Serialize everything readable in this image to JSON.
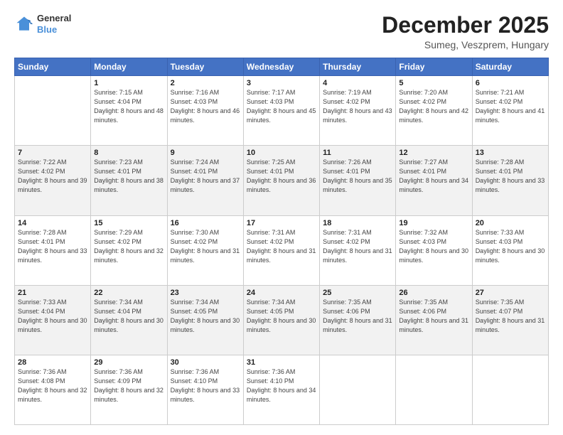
{
  "header": {
    "logo_general": "General",
    "logo_blue": "Blue",
    "month_year": "December 2025",
    "location": "Sumeg, Veszprem, Hungary"
  },
  "calendar": {
    "days_of_week": [
      "Sunday",
      "Monday",
      "Tuesday",
      "Wednesday",
      "Thursday",
      "Friday",
      "Saturday"
    ],
    "weeks": [
      [
        {
          "day": "",
          "sunrise": "",
          "sunset": "",
          "daylight": ""
        },
        {
          "day": "1",
          "sunrise": "Sunrise: 7:15 AM",
          "sunset": "Sunset: 4:04 PM",
          "daylight": "Daylight: 8 hours and 48 minutes."
        },
        {
          "day": "2",
          "sunrise": "Sunrise: 7:16 AM",
          "sunset": "Sunset: 4:03 PM",
          "daylight": "Daylight: 8 hours and 46 minutes."
        },
        {
          "day": "3",
          "sunrise": "Sunrise: 7:17 AM",
          "sunset": "Sunset: 4:03 PM",
          "daylight": "Daylight: 8 hours and 45 minutes."
        },
        {
          "day": "4",
          "sunrise": "Sunrise: 7:19 AM",
          "sunset": "Sunset: 4:02 PM",
          "daylight": "Daylight: 8 hours and 43 minutes."
        },
        {
          "day": "5",
          "sunrise": "Sunrise: 7:20 AM",
          "sunset": "Sunset: 4:02 PM",
          "daylight": "Daylight: 8 hours and 42 minutes."
        },
        {
          "day": "6",
          "sunrise": "Sunrise: 7:21 AM",
          "sunset": "Sunset: 4:02 PM",
          "daylight": "Daylight: 8 hours and 41 minutes."
        }
      ],
      [
        {
          "day": "7",
          "sunrise": "Sunrise: 7:22 AM",
          "sunset": "Sunset: 4:02 PM",
          "daylight": "Daylight: 8 hours and 39 minutes."
        },
        {
          "day": "8",
          "sunrise": "Sunrise: 7:23 AM",
          "sunset": "Sunset: 4:01 PM",
          "daylight": "Daylight: 8 hours and 38 minutes."
        },
        {
          "day": "9",
          "sunrise": "Sunrise: 7:24 AM",
          "sunset": "Sunset: 4:01 PM",
          "daylight": "Daylight: 8 hours and 37 minutes."
        },
        {
          "day": "10",
          "sunrise": "Sunrise: 7:25 AM",
          "sunset": "Sunset: 4:01 PM",
          "daylight": "Daylight: 8 hours and 36 minutes."
        },
        {
          "day": "11",
          "sunrise": "Sunrise: 7:26 AM",
          "sunset": "Sunset: 4:01 PM",
          "daylight": "Daylight: 8 hours and 35 minutes."
        },
        {
          "day": "12",
          "sunrise": "Sunrise: 7:27 AM",
          "sunset": "Sunset: 4:01 PM",
          "daylight": "Daylight: 8 hours and 34 minutes."
        },
        {
          "day": "13",
          "sunrise": "Sunrise: 7:28 AM",
          "sunset": "Sunset: 4:01 PM",
          "daylight": "Daylight: 8 hours and 33 minutes."
        }
      ],
      [
        {
          "day": "14",
          "sunrise": "Sunrise: 7:28 AM",
          "sunset": "Sunset: 4:01 PM",
          "daylight": "Daylight: 8 hours and 33 minutes."
        },
        {
          "day": "15",
          "sunrise": "Sunrise: 7:29 AM",
          "sunset": "Sunset: 4:02 PM",
          "daylight": "Daylight: 8 hours and 32 minutes."
        },
        {
          "day": "16",
          "sunrise": "Sunrise: 7:30 AM",
          "sunset": "Sunset: 4:02 PM",
          "daylight": "Daylight: 8 hours and 31 minutes."
        },
        {
          "day": "17",
          "sunrise": "Sunrise: 7:31 AM",
          "sunset": "Sunset: 4:02 PM",
          "daylight": "Daylight: 8 hours and 31 minutes."
        },
        {
          "day": "18",
          "sunrise": "Sunrise: 7:31 AM",
          "sunset": "Sunset: 4:02 PM",
          "daylight": "Daylight: 8 hours and 31 minutes."
        },
        {
          "day": "19",
          "sunrise": "Sunrise: 7:32 AM",
          "sunset": "Sunset: 4:03 PM",
          "daylight": "Daylight: 8 hours and 30 minutes."
        },
        {
          "day": "20",
          "sunrise": "Sunrise: 7:33 AM",
          "sunset": "Sunset: 4:03 PM",
          "daylight": "Daylight: 8 hours and 30 minutes."
        }
      ],
      [
        {
          "day": "21",
          "sunrise": "Sunrise: 7:33 AM",
          "sunset": "Sunset: 4:04 PM",
          "daylight": "Daylight: 8 hours and 30 minutes."
        },
        {
          "day": "22",
          "sunrise": "Sunrise: 7:34 AM",
          "sunset": "Sunset: 4:04 PM",
          "daylight": "Daylight: 8 hours and 30 minutes."
        },
        {
          "day": "23",
          "sunrise": "Sunrise: 7:34 AM",
          "sunset": "Sunset: 4:05 PM",
          "daylight": "Daylight: 8 hours and 30 minutes."
        },
        {
          "day": "24",
          "sunrise": "Sunrise: 7:34 AM",
          "sunset": "Sunset: 4:05 PM",
          "daylight": "Daylight: 8 hours and 30 minutes."
        },
        {
          "day": "25",
          "sunrise": "Sunrise: 7:35 AM",
          "sunset": "Sunset: 4:06 PM",
          "daylight": "Daylight: 8 hours and 31 minutes."
        },
        {
          "day": "26",
          "sunrise": "Sunrise: 7:35 AM",
          "sunset": "Sunset: 4:06 PM",
          "daylight": "Daylight: 8 hours and 31 minutes."
        },
        {
          "day": "27",
          "sunrise": "Sunrise: 7:35 AM",
          "sunset": "Sunset: 4:07 PM",
          "daylight": "Daylight: 8 hours and 31 minutes."
        }
      ],
      [
        {
          "day": "28",
          "sunrise": "Sunrise: 7:36 AM",
          "sunset": "Sunset: 4:08 PM",
          "daylight": "Daylight: 8 hours and 32 minutes."
        },
        {
          "day": "29",
          "sunrise": "Sunrise: 7:36 AM",
          "sunset": "Sunset: 4:09 PM",
          "daylight": "Daylight: 8 hours and 32 minutes."
        },
        {
          "day": "30",
          "sunrise": "Sunrise: 7:36 AM",
          "sunset": "Sunset: 4:10 PM",
          "daylight": "Daylight: 8 hours and 33 minutes."
        },
        {
          "day": "31",
          "sunrise": "Sunrise: 7:36 AM",
          "sunset": "Sunset: 4:10 PM",
          "daylight": "Daylight: 8 hours and 34 minutes."
        },
        {
          "day": "",
          "sunrise": "",
          "sunset": "",
          "daylight": ""
        },
        {
          "day": "",
          "sunrise": "",
          "sunset": "",
          "daylight": ""
        },
        {
          "day": "",
          "sunrise": "",
          "sunset": "",
          "daylight": ""
        }
      ]
    ]
  }
}
